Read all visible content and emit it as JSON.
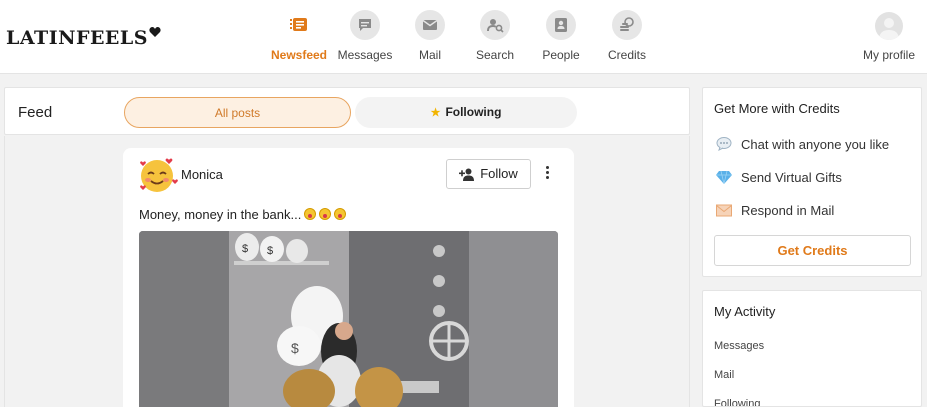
{
  "app": {
    "logo_text": "LATINFEELS"
  },
  "nav": {
    "items": [
      {
        "label": "Newsfeed",
        "icon": "newsfeed-icon",
        "active": true
      },
      {
        "label": "Messages",
        "icon": "chat-bubble-icon"
      },
      {
        "label": "Mail",
        "icon": "envelope-icon"
      },
      {
        "label": "Search",
        "icon": "search-people-icon"
      },
      {
        "label": "People",
        "icon": "id-card-icon"
      },
      {
        "label": "Credits",
        "icon": "coins-icon"
      }
    ],
    "profile_label": "My profile"
  },
  "feed": {
    "title": "Feed",
    "tabs": {
      "all_posts": "All posts",
      "following": "Following"
    },
    "post": {
      "author": "Monica",
      "follow_label": "Follow",
      "text": "Money, money in the bank..."
    }
  },
  "credits_card": {
    "title": "Get More with Credits",
    "items": [
      {
        "label": "Chat with anyone you like",
        "icon": "speech-bubble-icon"
      },
      {
        "label": "Send Virtual Gifts",
        "icon": "diamond-icon"
      },
      {
        "label": "Respond in Mail",
        "icon": "envelope-icon"
      }
    ],
    "button_label": "Get Credits"
  },
  "activity": {
    "title": "My Activity",
    "links": [
      "Messages",
      "Mail",
      "Following"
    ]
  },
  "colors": {
    "accent": "#e07a1a",
    "accent_soft": "#fdf0e2",
    "background": "#f2f2f2"
  }
}
